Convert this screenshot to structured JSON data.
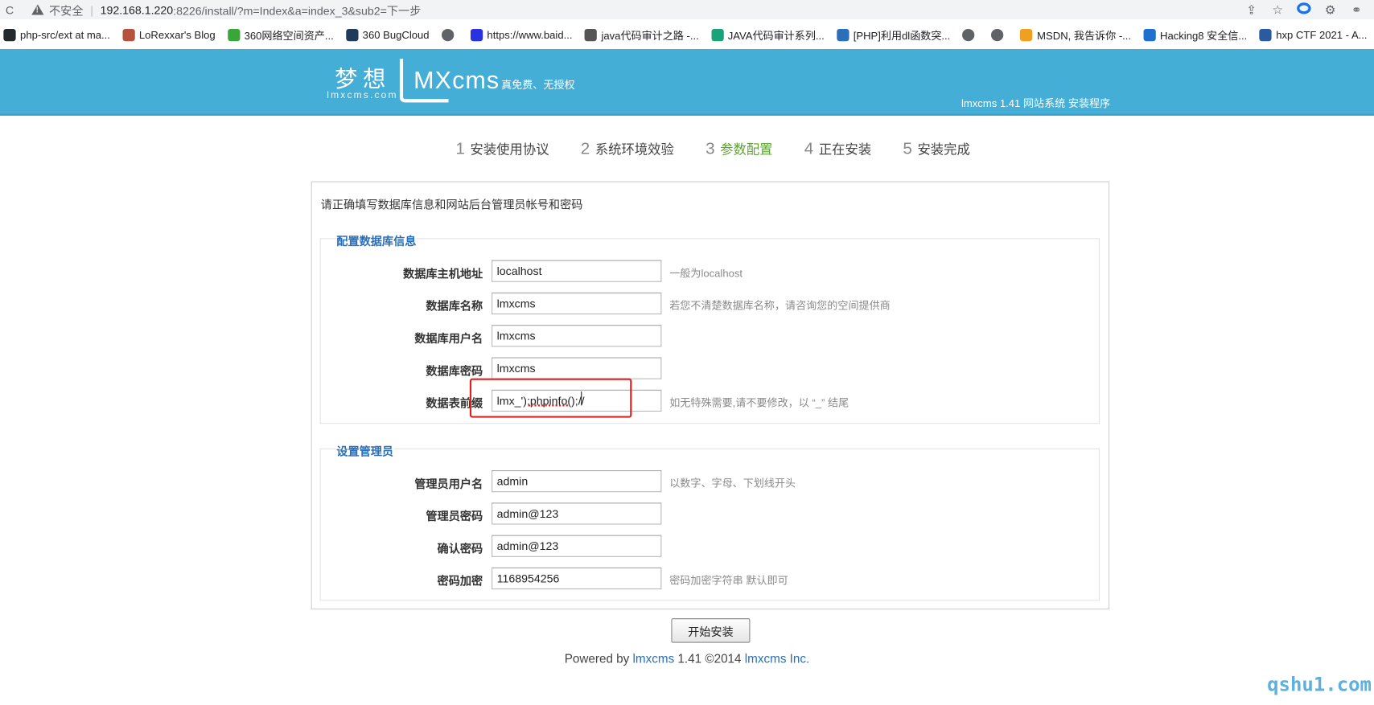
{
  "browser": {
    "security_label": "不安全",
    "url_host": "192.168.1.220",
    "url_rest": ":8226/install/?m=Index&a=index_3&sub2=下一步",
    "bookmarks": [
      {
        "label": "php-src/ext at ma...",
        "icon": "github-icon",
        "color": "#24292e"
      },
      {
        "label": "LoRexxar's Blog",
        "icon": "blog-icon",
        "color": "#b5523b"
      },
      {
        "label": "360网络空间资产...",
        "icon": "360-icon",
        "color": "#3aa63a"
      },
      {
        "label": "360 BugCloud",
        "icon": "bugcloud-icon",
        "color": "#1f3a5a"
      },
      {
        "label": "",
        "icon": "globe-icon",
        "color": "#5f6368"
      },
      {
        "label": "https://www.baid...",
        "icon": "baidu-icon",
        "color": "#2932e1"
      },
      {
        "label": "java代码审计之路 -...",
        "icon": "feather-icon",
        "color": "#555555"
      },
      {
        "label": "JAVA代码审计系列...",
        "icon": "e-icon",
        "color": "#1aa37a"
      },
      {
        "label": "[PHP]利用dl函数突...",
        "icon": "clock-icon",
        "color": "#2a6fb8"
      },
      {
        "label": "",
        "icon": "globe-icon",
        "color": "#5f6368"
      },
      {
        "label": "",
        "icon": "globe-icon",
        "color": "#5f6368"
      },
      {
        "label": "MSDN, 我告诉你 -...",
        "icon": "msdn-icon",
        "color": "#f0a020"
      },
      {
        "label": "Hacking8 安全信...",
        "icon": "h-icon",
        "color": "#1e6fd0"
      },
      {
        "label": "hxp CTF 2021 - A...",
        "icon": "ctf-icon",
        "color": "#2a5aa0"
      }
    ]
  },
  "header": {
    "logo_cn": "梦想",
    "logo_domain": "lmxcms.com",
    "logo_brand": "MXcms",
    "logo_tagline": "真免费、无授权",
    "version_text": "lmxcms 1.41 网站系统 安装程序"
  },
  "steps": [
    {
      "num": "1",
      "label": "安装使用协议",
      "active": false
    },
    {
      "num": "2",
      "label": "系统环境效验",
      "active": false
    },
    {
      "num": "3",
      "label": "参数配置",
      "active": true
    },
    {
      "num": "4",
      "label": "正在安装",
      "active": false
    },
    {
      "num": "5",
      "label": "安装完成",
      "active": false
    }
  ],
  "form": {
    "intro": "请正确填写数据库信息和网站后台管理员帐号和密码",
    "db_section": {
      "title": "配置数据库信息",
      "fields": [
        {
          "label": "数据库主机地址",
          "value": "localhost",
          "hint": "一般为localhost"
        },
        {
          "label": "数据库名称",
          "value": "lmxcms",
          "hint": "若您不清楚数据库名称，请咨询您的空间提供商"
        },
        {
          "label": "数据库用户名",
          "value": "lmxcms",
          "hint": ""
        },
        {
          "label": "数据库密码",
          "value": "lmxcms",
          "hint": ""
        },
        {
          "label": "数据表前缀",
          "value": "lmx_');phpinfo();//",
          "hint": "如无特殊需要,请不要修改，以 “_” 结尾"
        }
      ]
    },
    "admin_section": {
      "title": "设置管理员",
      "fields": [
        {
          "label": "管理员用户名",
          "value": "admin",
          "hint": "以数字、字母、下划线开头"
        },
        {
          "label": "管理员密码",
          "value": "admin@123",
          "hint": ""
        },
        {
          "label": "确认密码",
          "value": "admin@123",
          "hint": ""
        },
        {
          "label": "密码加密",
          "value": "1168954256",
          "hint": "密码加密字符串 默认即可"
        }
      ]
    },
    "submit_label": "开始安装"
  },
  "footer": {
    "prefix": "Powered by ",
    "link1": "lmxcms",
    "middle": " 1.41 ©2014 ",
    "link2": "lmxcms Inc."
  },
  "watermark": "qshu1.com"
}
